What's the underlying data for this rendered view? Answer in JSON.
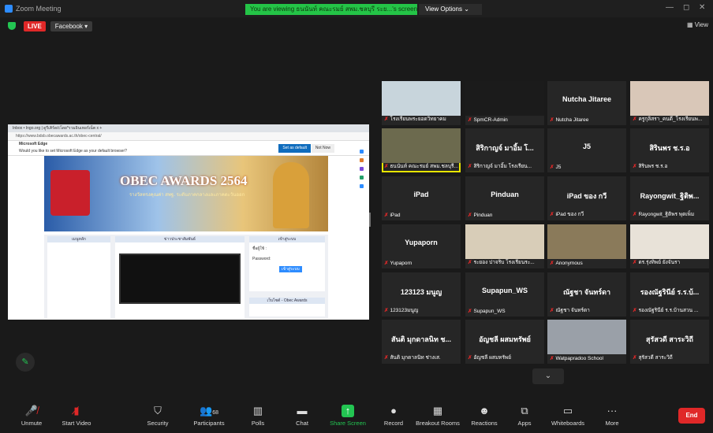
{
  "window": {
    "title": "Zoom Meeting"
  },
  "banner": {
    "viewing_text": "You are viewing ธนนันท์ คณะรมย์ สพม.ชลบุรี ระย...'s screen",
    "view_options": "View Options"
  },
  "topbar": {
    "live": "LIVE",
    "facebook": "Facebook",
    "view": "View"
  },
  "shared_screen": {
    "tabs": "Inbox • Ingo.org  |  ดูรีเคิร์ด/cโดย*รวมอินเทอร์เน็ต  x  +",
    "address": "https://www.bdsb.obecawards.ac.th/obec-central/",
    "edge_title": "Microsoft Edge",
    "edge_msg": "Would you like to set Microsoft Edge as your default browser?",
    "edge_set": "Set as default",
    "edge_not": "Not Now",
    "banner_title": "OBEC AWARDS 2564",
    "banner_sub": "รางวัลทรงคุณค่า สพฐ. ระดับภาคกลางและภาคตะวันออก",
    "col_menu": "เมนูหลัก",
    "col_news": "ข่าวประชาสัมพันธ์",
    "col_login": "เข้าสู่ระบบ",
    "login_user": "ชื่อผู้ใช้ :",
    "login_pass": "Password:",
    "login_btn": "เข้าสู่ระบบ",
    "news_bottom": "เว็บไซต์ - Obec Awards"
  },
  "participants": [
    {
      "name": "",
      "label": "โรงเรียนพระยอดวิทยาคม",
      "photo": "#c8d5dc"
    },
    {
      "name": "",
      "label": "SpmCR-Admin",
      "photo": "#1b1b1b"
    },
    {
      "name": "Nutcha Jitaree",
      "label": "Nutcha Jitaree",
      "photo": ""
    },
    {
      "name": "",
      "label": "ครูกุลิสรา_คนดี_โรงเรียนพ...",
      "photo": "#d9c7b8"
    },
    {
      "name": "",
      "label": "ธนนันท์ คณะรมย์ สพม.ชลบุรี...",
      "photo": "#6c6a4e"
    },
    {
      "name": "สิริกาญจ์ มาอิ้ม โ...",
      "label": "สิริกาญจ์ มาอิ้ม โรงเรียน...",
      "photo": ""
    },
    {
      "name": "J5",
      "label": "J5",
      "photo": ""
    },
    {
      "name": "สิรินพร ช.ร.อ",
      "label": "สิรินพร ช.ร.อ",
      "photo": ""
    },
    {
      "name": "iPad",
      "label": "iPad",
      "photo": ""
    },
    {
      "name": "Pinduan",
      "label": "Pinduan",
      "photo": ""
    },
    {
      "name": "iPad ของ กวี",
      "label": "iPad ของ กวี",
      "photo": ""
    },
    {
      "name": "Rayongwit_ฐิติพ...",
      "label": "Rayongwit_ฐิติพร พุดเพ็ม",
      "photo": ""
    },
    {
      "name": "Yupaporn",
      "label": "Yupaporn",
      "photo": ""
    },
    {
      "name": "",
      "label": "ระยอง ปาจริบ โรงเรียนระ...",
      "photo": "#d8cdb8"
    },
    {
      "name": "",
      "label": "Anonymous",
      "photo": "#8a7a5a"
    },
    {
      "name": "",
      "label": "ดร.รุ่งทิพย์ ยังจันรา",
      "photo": "#e8e2d8"
    },
    {
      "name": "123123 มนูญ",
      "label": "123123มนูญ",
      "photo": ""
    },
    {
      "name": "Supapun_WS",
      "label": "Supapun_WS",
      "photo": ""
    },
    {
      "name": "ณัฐชา จันทร์ดา",
      "label": "ณัฐชา จันทร์ดา",
      "photo": ""
    },
    {
      "name": "รองณัฐรินีย์ ร.ร.บ้...",
      "label": "รองณัฐรินีย์ ร.ร.บ้านสวน ...",
      "photo": ""
    },
    {
      "name": "สันติ มุกดาลนิท ช...",
      "label": "สันติ มุกดาลนิท ช่างเส.",
      "photo": ""
    },
    {
      "name": "อัญชลี ผสมทรัพย์",
      "label": "อัญชลี ผสมทรัพย์",
      "photo": ""
    },
    {
      "name": "",
      "label": "Watpapradoo School",
      "photo": "#9aa0a8"
    },
    {
      "name": "สุรัสวดี สาระวิถี",
      "label": "สุรัสวดี สาระวิถี",
      "photo": ""
    }
  ],
  "toolbar": {
    "unmute": "Unmute",
    "start_video": "Start Video",
    "security": "Security",
    "participants": "Participants",
    "participants_count": "68",
    "polls": "Polls",
    "chat": "Chat",
    "share": "Share Screen",
    "record": "Record",
    "breakout": "Breakout Rooms",
    "reactions": "Reactions",
    "apps": "Apps",
    "whiteboards": "Whiteboards",
    "more": "More",
    "end": "End"
  },
  "colors": {
    "accent": "#23c552",
    "end": "#e02828",
    "zoom_blue": "#2d8cff"
  }
}
